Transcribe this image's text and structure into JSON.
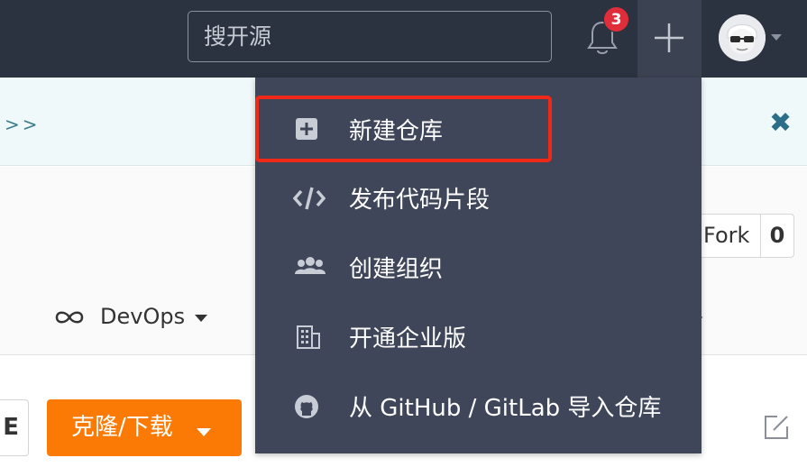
{
  "topbar": {
    "search_placeholder": "搜开源",
    "notification_count": "3"
  },
  "banner": {
    "text": ">>"
  },
  "repo": {
    "fork_label": "Fork",
    "fork_count": "0",
    "devops_label": "DevOps"
  },
  "actions": {
    "left_button_text": "E",
    "clone_label": "克隆/下载"
  },
  "menu": {
    "items": [
      {
        "label": "新建仓库",
        "icon": "plus-square-icon"
      },
      {
        "label": "发布代码片段",
        "icon": "code-icon"
      },
      {
        "label": "创建组织",
        "icon": "users-icon"
      },
      {
        "label": "开通企业版",
        "icon": "building-icon"
      },
      {
        "label": "从 GitHub / GitLab 导入仓库",
        "icon": "github-icon"
      }
    ]
  },
  "colors": {
    "topbar": "#2b3240",
    "menu": "#3f4659",
    "clone_button": "#fa7a05",
    "highlight": "#f02818",
    "badge": "#e02d3b"
  }
}
